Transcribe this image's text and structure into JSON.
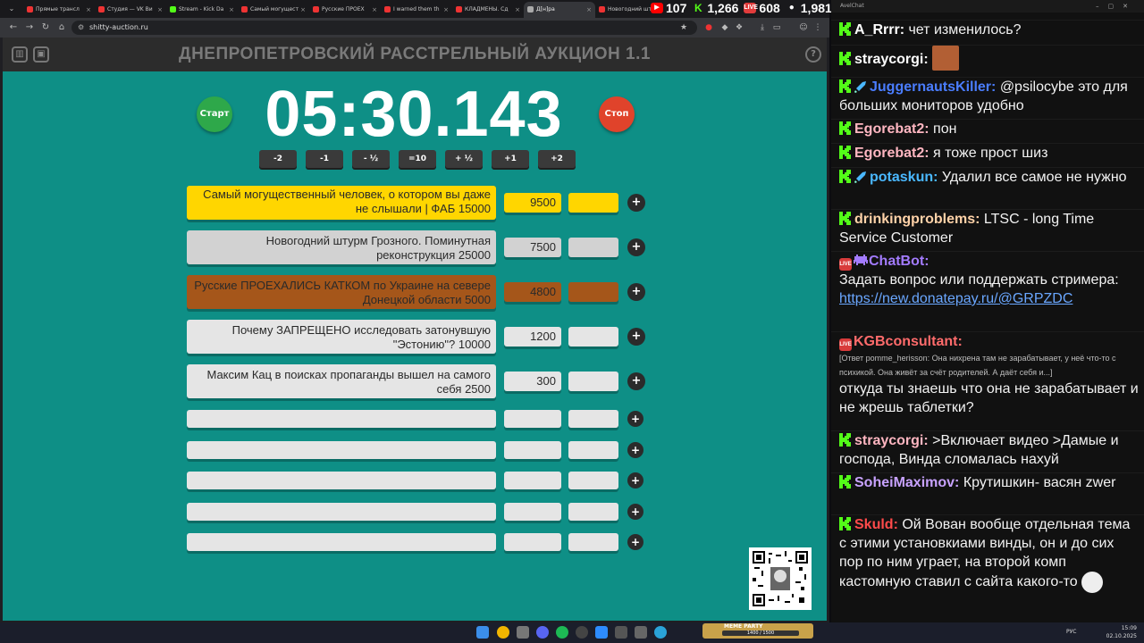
{
  "browser": {
    "tabs": [
      {
        "label": "Прямые трансл",
        "fav": "#e33"
      },
      {
        "label": "Студия — VK Ви",
        "fav": "#e33"
      },
      {
        "label": "Stream - Kick Da",
        "fav": "#53fc18"
      },
      {
        "label": "Самый могущест",
        "fav": "#e33"
      },
      {
        "label": "Русские ПРОЕХ",
        "fav": "#e33"
      },
      {
        "label": "I warned them th",
        "fav": "#e33"
      },
      {
        "label": "КЛАДМЕНЫ. Сд",
        "fav": "#e33"
      },
      {
        "label": "Д[н]ра",
        "fav": "#aaa"
      },
      {
        "label": "Новогодний шт",
        "fav": "#e33"
      }
    ],
    "url": "shitty-auction.ru",
    "stats": [
      {
        "icon": "youtube-icon",
        "color": "#ff0000",
        "value": "107"
      },
      {
        "icon": "kick-icon",
        "color": "#53fc18",
        "value": "1,266"
      },
      {
        "icon": "vk-live-icon",
        "color": "#e23b3b",
        "value": "608"
      },
      {
        "icon": "viewers-icon",
        "color": "#1a1a1a",
        "value": "1,981"
      }
    ]
  },
  "page": {
    "title": "ДНЕПРОПЕТРОВСКИЙ РАССТРЕЛЬНЫЙ АУКЦИОН 1.1",
    "timer": "05:30.143",
    "start_label": "Старт",
    "stop_label": "Стоп",
    "adjust": [
      "-2",
      "-1",
      "- ½",
      "=10",
      "+ ½",
      "+1",
      "+2"
    ],
    "colors": {
      "gold": "#ffd600",
      "silver": "#d2d2d2",
      "bronze": "#a5561a",
      "plain": "#e5e5e5",
      "bg": "#0e8f86"
    },
    "lots": [
      {
        "name": "Самый могущественный человек, о котором вы даже не слышали | ФАБ 15000",
        "amount": "9500",
        "tier": "gold"
      },
      {
        "name": "Новогодний штурм Грозного. Поминутная реконструкция 25000",
        "amount": "7500",
        "tier": "silver"
      },
      {
        "name": "Русские ПРОЕХАЛИСЬ КАТКОМ по Украине на севере Донецкой области 5000",
        "amount": "4800",
        "tier": "bronze"
      },
      {
        "name": "Почему ЗАПРЕЩЕНО исследовать затонувшую \"Эстонию\"? 10000",
        "amount": "1200",
        "tier": "plain"
      },
      {
        "name": "Максим Кац в поисках пропаганды вышел на самого себя 2500",
        "amount": "300",
        "tier": "plain"
      }
    ],
    "empty_rows": 5,
    "plus": "+"
  },
  "taskbar": {
    "lang": "РУС",
    "time": "15:09",
    "date": "02.10.2025",
    "meme_title": "MEME PARTY",
    "meme_progress": "1400 / 1500"
  },
  "chat": {
    "window_title": "AvelChat",
    "messages": [
      {
        "user": "A_Rrrr",
        "color": "#ffffff",
        "text": "чет изменилось?",
        "badge": "kick"
      },
      {
        "user": "straycorgi",
        "color": "#ffffff",
        "text": "",
        "badge": "kick",
        "emote": "laughing-emote"
      },
      {
        "user": "JuggernautsKiller",
        "color": "#4a7dff",
        "text": "@psilocybe это для больших мониторов удобно",
        "badge": "kick",
        "sword": true
      },
      {
        "user": "Egorebat2",
        "color": "#ffb6c1",
        "text": "пон",
        "badge": "kick"
      },
      {
        "user": "Egorebat2",
        "color": "#ffb6c1",
        "text": "я тоже прост шиз",
        "badge": "kick"
      },
      {
        "user": "potaskun",
        "color": "#4ab8ff",
        "text": "Удалил все самое не нужно",
        "badge": "kick",
        "sword": true
      },
      {
        "user": "drinkingproblems",
        "color": "#ffd2a8",
        "text": "LTSC - long Time Service Customer",
        "badge": "kick"
      },
      {
        "user": "ChatBot",
        "color": "#a37bff",
        "text": "Задать вопрос или поддержать стримера:",
        "link": "https://new.donatepay.ru/@GRPZDC",
        "badge": "live"
      },
      {
        "user": "KGBconsultant",
        "color": "#ff6b6b",
        "reply": "[Ответ pomme_herisson: Она нихрена там не зарабатывает, у неё что-то с психикой. Она живёт за счёт родителей. А даёт себя и...]",
        "text": "откуда ты знаешь что она не зарабатывает и не жрешь таблетки?",
        "badge": "live"
      },
      {
        "user": "straycorgi",
        "color": "#ffb6c1",
        "text": ">Включает видео >Дамые и господа, Винда сломалась нахуй",
        "badge": "kick"
      },
      {
        "user": "SoheiMaximov",
        "color": "#c8a2ff",
        "text": "Крутишкин- васян zwer",
        "badge": "kick"
      },
      {
        "user": "Skuld",
        "color": "#ff4a4a",
        "text": "Ой Вован вообще отдельная тема с этими установкиами винды, он и до сих пор по ним уграет, на второй комп кастомную ставил с сайта какого-то",
        "badge": "kick",
        "emote2": "joker-emote"
      }
    ]
  }
}
